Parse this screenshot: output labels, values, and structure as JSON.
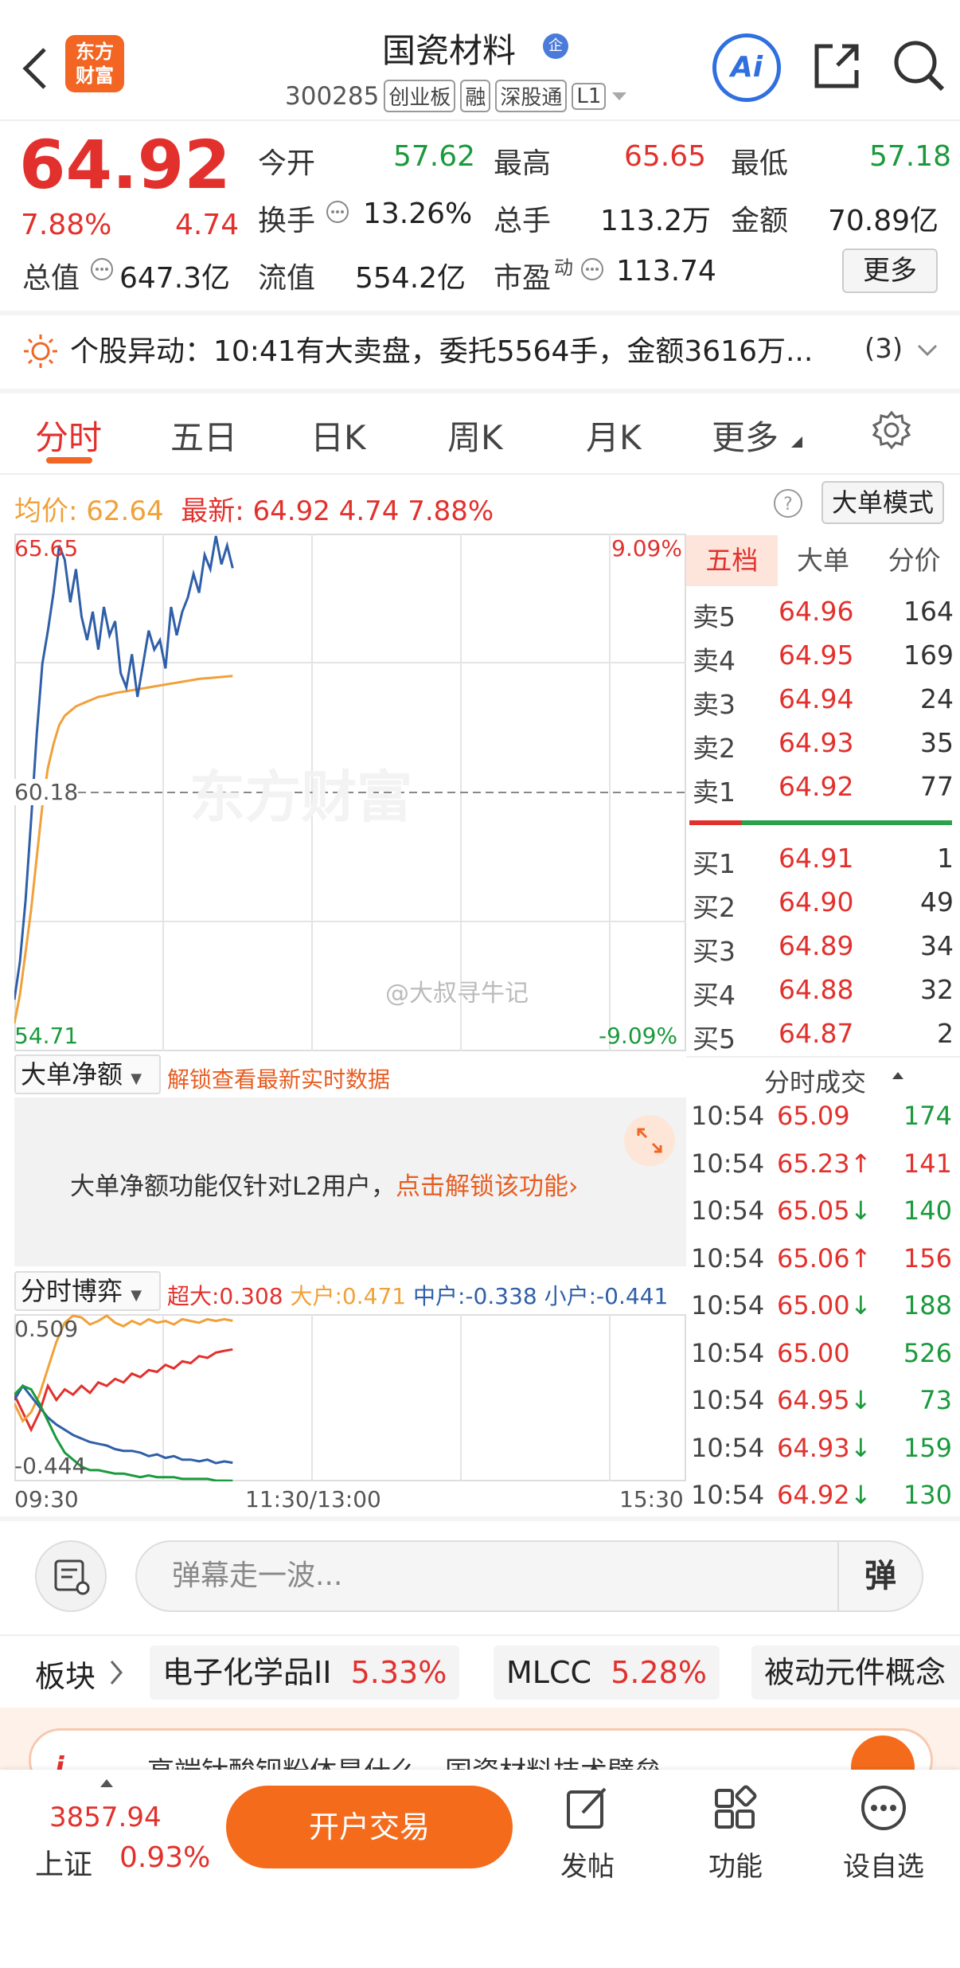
{
  "header": {
    "logo_line1": "东方",
    "logo_line2": "财富",
    "title": "国瓷材料",
    "title_badge": "企",
    "code": "300285",
    "tags": [
      "创业板",
      "融",
      "深股通",
      "L1"
    ],
    "ai_label": "Ai"
  },
  "quote": {
    "price": "64.92",
    "change_pct": "7.88%",
    "change": "4.74",
    "fields": {
      "open_label": "今开",
      "open": "57.62",
      "high_label": "最高",
      "high": "65.65",
      "low_label": "最低",
      "low": "57.18",
      "turnover_label": "换手",
      "turnover": "13.26%",
      "volume_label": "总手",
      "volume": "113.2万",
      "amount_label": "金额",
      "amount": "70.89亿",
      "mktcap_label": "总值",
      "mktcap": "647.3亿",
      "float_label": "流值",
      "float": "554.2亿",
      "pe_label": "市盈",
      "pe_sup": "动",
      "pe": "113.74"
    },
    "more_label": "更多"
  },
  "alert": {
    "text": "个股异动：10:41有大卖盘，委托5564手，金额3616万...",
    "count": "(3)"
  },
  "tabs": [
    "分时",
    "五日",
    "日K",
    "周K",
    "月K",
    "更多"
  ],
  "info": {
    "avg_label": "均价:",
    "avg": "62.64",
    "latest_label": "最新:",
    "latest": "64.92",
    "change": "4.74",
    "change_pct": "7.88%",
    "mode_btn": "大单模式"
  },
  "chart_axes": {
    "top_price": "65.65",
    "mid_price": "60.18",
    "bottom_price": "54.71",
    "top_pct": "9.09%",
    "bottom_pct": "-9.09%",
    "watermark": "东方财富",
    "weibo": "@大叔寻牛记"
  },
  "chart_data": [
    {
      "type": "line",
      "title": "",
      "x_range": [
        "09:30",
        "15:30"
      ],
      "ylim": [
        54.71,
        65.65
      ],
      "reference": 60.18,
      "series": [
        {
          "name": "最新",
          "color": "#2f5fa8",
          "x": [
            0,
            2,
            4,
            6,
            8,
            10,
            12,
            14,
            16,
            18,
            20,
            22,
            24,
            26,
            28,
            30,
            32,
            34,
            36,
            38,
            40,
            42,
            44,
            46,
            48,
            50,
            52,
            54,
            56,
            58,
            60,
            62,
            64,
            66,
            68,
            70,
            72,
            74,
            76,
            78
          ],
          "values": [
            55.8,
            56.6,
            57.9,
            59.6,
            61.4,
            62.9,
            63.6,
            64.4,
            65.4,
            65.1,
            64.2,
            64.9,
            63.9,
            63.4,
            64.0,
            63.2,
            64.1,
            63.5,
            63.8,
            62.7,
            62.4,
            63.1,
            62.2,
            62.9,
            63.6,
            63.2,
            63.4,
            62.8,
            64.1,
            63.5,
            64.0,
            64.3,
            64.8,
            64.4,
            65.2,
            64.9,
            65.6,
            65.0,
            65.4,
            64.92
          ]
        },
        {
          "name": "均价",
          "color": "#f0a13a",
          "x": [
            0,
            2,
            4,
            6,
            8,
            10,
            12,
            14,
            16,
            18,
            20,
            22,
            24,
            26,
            28,
            30,
            32,
            34,
            36,
            38,
            40,
            42,
            44,
            46,
            48,
            50,
            52,
            54,
            56,
            58,
            60,
            62,
            64,
            66,
            68,
            70,
            72,
            74,
            76,
            78
          ],
          "values": [
            55.3,
            55.9,
            56.8,
            57.7,
            58.8,
            59.9,
            60.7,
            61.2,
            61.6,
            61.8,
            61.9,
            62.0,
            62.05,
            62.1,
            62.15,
            62.2,
            62.22,
            62.25,
            62.28,
            62.3,
            62.32,
            62.34,
            62.36,
            62.38,
            62.4,
            62.42,
            62.44,
            62.46,
            62.48,
            62.5,
            62.52,
            62.54,
            62.56,
            62.58,
            62.59,
            62.6,
            62.61,
            62.62,
            62.63,
            62.64
          ]
        }
      ]
    },
    {
      "type": "line",
      "title": "分时博弈",
      "x_range": [
        "09:30",
        "15:30"
      ],
      "ylim": [
        -0.444,
        0.509
      ],
      "series": [
        {
          "name": "超大",
          "color": "#e2312d",
          "x": [
            0,
            3,
            6,
            9,
            12,
            15,
            18,
            21,
            24,
            27,
            30,
            33,
            36,
            39,
            42,
            45,
            48,
            51,
            54,
            57,
            60,
            63,
            66,
            69,
            72,
            75,
            78
          ],
          "values": [
            0.05,
            -0.05,
            -0.15,
            -0.05,
            0.1,
            0.02,
            0.08,
            0.05,
            0.1,
            0.06,
            0.12,
            0.1,
            0.14,
            0.12,
            0.17,
            0.15,
            0.19,
            0.18,
            0.22,
            0.2,
            0.24,
            0.23,
            0.27,
            0.26,
            0.29,
            0.3,
            0.308
          ]
        },
        {
          "name": "大户",
          "color": "#f0a13a",
          "x": [
            0,
            3,
            6,
            9,
            12,
            15,
            18,
            21,
            24,
            27,
            30,
            33,
            36,
            39,
            42,
            45,
            48,
            51,
            54,
            57,
            60,
            63,
            66,
            69,
            72,
            75,
            78
          ],
          "values": [
            0.0,
            -0.1,
            -0.05,
            0.05,
            0.2,
            0.35,
            0.46,
            0.5,
            0.49,
            0.45,
            0.47,
            0.5,
            0.46,
            0.44,
            0.47,
            0.45,
            0.48,
            0.46,
            0.47,
            0.45,
            0.48,
            0.47,
            0.46,
            0.48,
            0.47,
            0.48,
            0.471
          ]
        },
        {
          "name": "中户",
          "color": "#2f5fa8",
          "x": [
            0,
            3,
            6,
            9,
            12,
            15,
            18,
            21,
            24,
            27,
            30,
            33,
            36,
            39,
            42,
            45,
            48,
            51,
            54,
            57,
            60,
            63,
            66,
            69,
            72,
            75,
            78
          ],
          "values": [
            0.02,
            0.1,
            0.04,
            -0.02,
            -0.08,
            -0.12,
            -0.15,
            -0.18,
            -0.2,
            -0.22,
            -0.23,
            -0.24,
            -0.26,
            -0.27,
            -0.27,
            -0.28,
            -0.3,
            -0.29,
            -0.31,
            -0.3,
            -0.32,
            -0.32,
            -0.33,
            -0.32,
            -0.34,
            -0.33,
            -0.338
          ]
        },
        {
          "name": "小户",
          "color": "#1a9a3c",
          "x": [
            0,
            3,
            6,
            9,
            12,
            15,
            18,
            21,
            24,
            27,
            30,
            33,
            36,
            39,
            42,
            45,
            48,
            51,
            54,
            57,
            60,
            63,
            66,
            69,
            72,
            75,
            78
          ],
          "values": [
            0.05,
            0.1,
            0.08,
            0.0,
            -0.1,
            -0.2,
            -0.28,
            -0.32,
            -0.36,
            -0.38,
            -0.38,
            -0.39,
            -0.4,
            -0.4,
            -0.41,
            -0.42,
            -0.41,
            -0.42,
            -0.42,
            -0.42,
            -0.43,
            -0.43,
            -0.43,
            -0.43,
            -0.44,
            -0.44,
            -0.441
          ]
        }
      ]
    }
  ],
  "orderbook": {
    "tabs": [
      "五档",
      "大单",
      "分价"
    ],
    "asks": [
      {
        "label": "卖5",
        "price": "64.96",
        "vol": "164"
      },
      {
        "label": "卖4",
        "price": "64.95",
        "vol": "169"
      },
      {
        "label": "卖3",
        "price": "64.94",
        "vol": "24"
      },
      {
        "label": "卖2",
        "price": "64.93",
        "vol": "35"
      },
      {
        "label": "卖1",
        "price": "64.92",
        "vol": "77"
      }
    ],
    "bids": [
      {
        "label": "买1",
        "price": "64.91",
        "vol": "1"
      },
      {
        "label": "买2",
        "price": "64.90",
        "vol": "49"
      },
      {
        "label": "买3",
        "price": "64.89",
        "vol": "34"
      },
      {
        "label": "买4",
        "price": "64.88",
        "vol": "32"
      },
      {
        "label": "买5",
        "price": "64.87",
        "vol": "2"
      }
    ]
  },
  "bigorder": {
    "select": "大单净额",
    "unlock": "解锁查看最新实时数据",
    "notice": "大单净额功能仅针对L2用户，",
    "notice_link": "点击解锁该功能"
  },
  "game": {
    "select": "分时博弈",
    "legend": [
      {
        "label": "超大:0.308",
        "color": "#e2312d"
      },
      {
        "label": "大户:0.471",
        "color": "#f0a13a"
      },
      {
        "label": "中户:-0.338",
        "color": "#2f5fa8"
      },
      {
        "label": "小户:-0.441",
        "color": "#1a9a3c"
      }
    ],
    "top_val": "0.509",
    "bottom_val": "-0.444",
    "time_start": "09:30",
    "time_mid": "11:30/13:00",
    "time_end": "15:30"
  },
  "trades": {
    "title": "分时成交",
    "rows": [
      {
        "time": "10:54",
        "price": "65.09",
        "arrow": "",
        "vol": "174",
        "dir": "green"
      },
      {
        "time": "10:54",
        "price": "65.23",
        "arrow": "↑",
        "vol": "141",
        "dir": "red"
      },
      {
        "time": "10:54",
        "price": "65.05",
        "arrow": "↓",
        "vol": "140",
        "dir": "green"
      },
      {
        "time": "10:54",
        "price": "65.06",
        "arrow": "↑",
        "vol": "156",
        "dir": "red"
      },
      {
        "time": "10:54",
        "price": "65.00",
        "arrow": "↓",
        "vol": "188",
        "dir": "green"
      },
      {
        "time": "10:54",
        "price": "65.00",
        "arrow": "",
        "vol": "526",
        "dir": "green"
      },
      {
        "time": "10:54",
        "price": "64.95",
        "arrow": "↓",
        "vol": "73",
        "dir": "green"
      },
      {
        "time": "10:54",
        "price": "64.93",
        "arrow": "↓",
        "vol": "159",
        "dir": "green"
      },
      {
        "time": "10:54",
        "price": "64.92",
        "arrow": "↓",
        "vol": "130",
        "dir": "green"
      }
    ]
  },
  "danmu": {
    "placeholder": "弹幕走一波...",
    "btn": "弹"
  },
  "sectors": {
    "label": "板块",
    "items": [
      {
        "name": "电子化学品II",
        "pct": "5.33%"
      },
      {
        "name": "MLCC",
        "pct": "5.28%"
      },
      {
        "name": "被动元件概念",
        "pct": ""
      }
    ]
  },
  "banner": {
    "text": "高端钛酸钡粉体是什么，国瓷材料技术壁垒"
  },
  "bottom": {
    "index_value": "3857.94",
    "index_name": "上证",
    "index_pct": "0.93%",
    "open_btn": "开户交易",
    "nav": [
      "发帖",
      "功能",
      "设自选"
    ]
  }
}
